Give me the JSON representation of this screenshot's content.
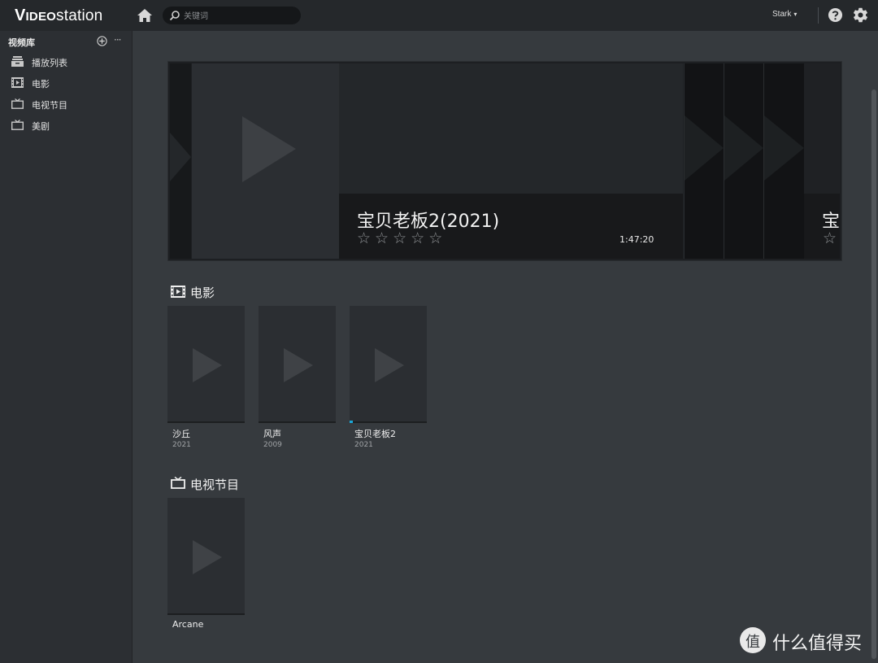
{
  "app": {
    "logo_prefix": "V",
    "logo_mid": "IDEO",
    "logo_suffix": "station"
  },
  "topbar": {
    "search_placeholder": "关键词",
    "user": "Stark",
    "icons": [
      "home-icon",
      "search-icon",
      "help-icon",
      "gear-icon"
    ]
  },
  "sidebar": {
    "title": "视频库",
    "add_icon": "plus-circle-icon",
    "more_label": "···",
    "items": [
      {
        "label": "播放列表",
        "icon": "playlist-icon"
      },
      {
        "label": "电影",
        "icon": "film-icon"
      },
      {
        "label": "电视节目",
        "icon": "tv-icon"
      },
      {
        "label": "美剧",
        "icon": "tv-icon"
      }
    ]
  },
  "featured": {
    "title": "宝贝老板2(2021)",
    "rating_stars": 5,
    "rating_value": 0,
    "duration": "1:47:20",
    "next_title_partial": "宝"
  },
  "sections": {
    "movies": {
      "title": "电影",
      "items": [
        {
          "name": "沙丘",
          "year": "2021"
        },
        {
          "name": "风声",
          "year": "2009"
        },
        {
          "name": "宝贝老板2",
          "year": "2021"
        }
      ]
    },
    "tv": {
      "title": "电视节目",
      "items": [
        {
          "name": "Arcane"
        }
      ]
    }
  },
  "watermark": {
    "icon_text": "值",
    "text": "什么值得买"
  },
  "colors": {
    "topbar": "#25282b",
    "sidebar": "#2c2f33",
    "content": "#363a3e",
    "card": "#2b2e32",
    "accent": "#1aa8d8"
  }
}
